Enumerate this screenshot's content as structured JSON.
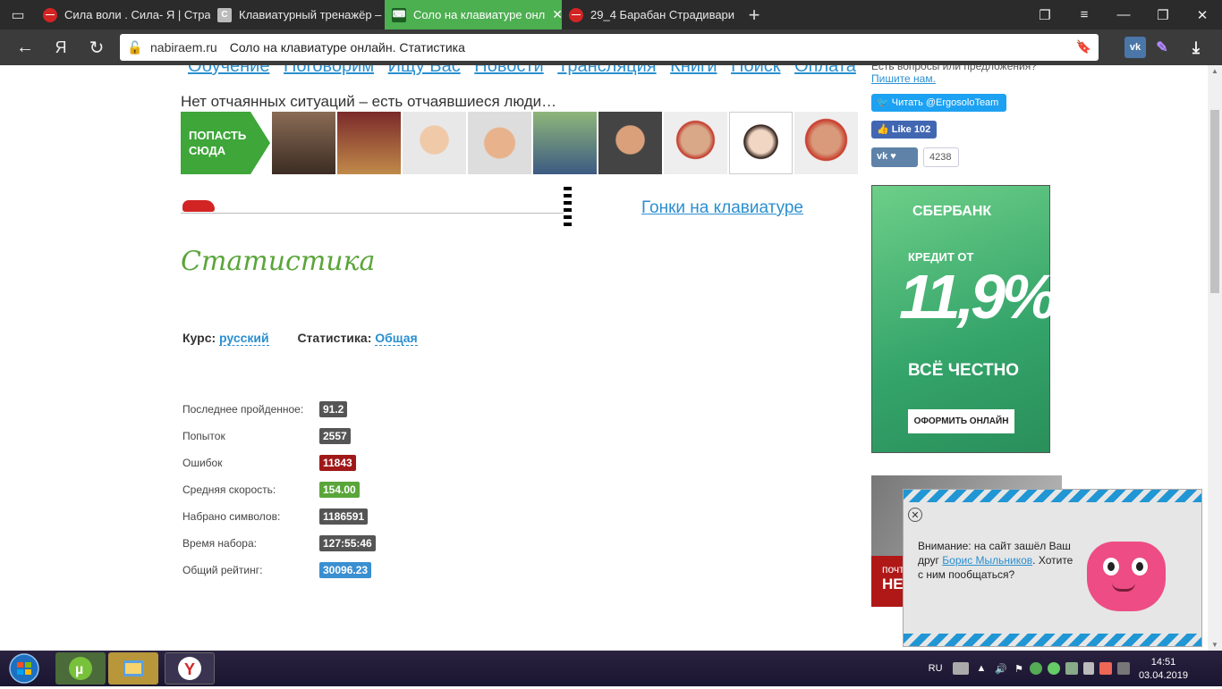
{
  "browser": {
    "tabs": [
      {
        "title": "Сила воли . Сила- Я | Стра",
        "favicon_color": "#d32424",
        "active": false
      },
      {
        "title": "Клавиатурный тренажёр –",
        "favicon_color": "#9e9e9e",
        "favicon_letter": "C",
        "active": false
      },
      {
        "title": "Соло на клавиатуре онл",
        "favicon_color": "#2e7d32",
        "active": true
      },
      {
        "title": "29_4 Барабан Страдивари",
        "favicon_color": "#d32424",
        "active": false
      }
    ],
    "new_tab": "+",
    "yandex_letter": "Я",
    "url_domain": "nabiraem.ru",
    "url_title": "Соло на клавиатуре онлайн. Статистика",
    "ext_vk": "vk"
  },
  "site": {
    "menu": [
      "Обучение",
      "Поговорим",
      "Ищу Вас",
      "Новости",
      "Трансляция",
      "Книги",
      "Поиск",
      "Оплата"
    ],
    "slogan": "Нет отчаянных ситуаций – есть отчаявшиеся люди…",
    "enter_button": "ПОПАСТЬ СЮДА",
    "races_link": "Гонки на клавиатуре",
    "page_title": "Статистика",
    "filters": {
      "course_label": "Курс:",
      "course_value": "русский",
      "stat_label": "Статистика:",
      "stat_value": "Общая"
    },
    "stats": [
      {
        "label": "Последнее пройденное:",
        "value": "91.2",
        "color": "#555555"
      },
      {
        "label": "Попыток",
        "value": "2557",
        "color": "#555555"
      },
      {
        "label": "Ошибок",
        "value": "11843",
        "color": "#a01818"
      },
      {
        "label": "Средняя скорость:",
        "value": "154.00",
        "color": "#5aa53a"
      },
      {
        "label": "Набрано символов:",
        "value": "1186591",
        "color": "#555555"
      },
      {
        "label": "Время набора:",
        "value": "127:55:46",
        "color": "#555555"
      },
      {
        "label": "Общий рейтинг:",
        "value": "30096.23",
        "color": "#3a8fd0"
      }
    ],
    "sidebar": {
      "question": "Есть вопросы или предложения?",
      "write_us": "Пишите нам.",
      "twitter": "Читать @ErgosoloTeam",
      "facebook": "Like 102",
      "vk_count": "4238"
    },
    "ad": {
      "bank": "СБЕРБАНК",
      "credit": "КРЕДИТ ОТ",
      "rate": "11,9%",
      "honest": "ВСЁ ЧЕСТНО",
      "order": "ОФОРМИТЬ ОНЛАЙН"
    },
    "ad2": {
      "line1": "почт",
      "line2": "НЕ"
    },
    "popup": {
      "text_before": "Внимание: на сайт зашёл Ваш друг ",
      "friend": "Борис Мыльников",
      "text_after": ". Хотите с ним пообщаться?"
    }
  },
  "taskbar": {
    "lang": "RU",
    "time": "14:51",
    "date": "03.04.2019"
  }
}
